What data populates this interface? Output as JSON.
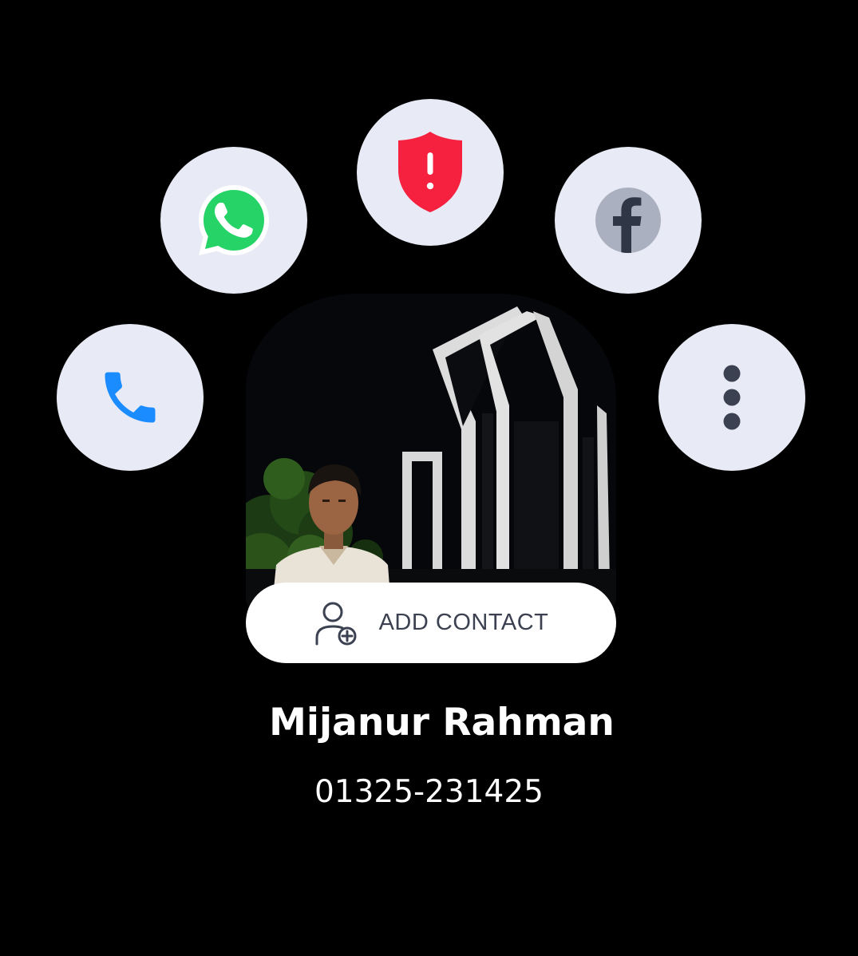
{
  "actions": {
    "call": {
      "icon": "phone-icon",
      "color": "#1a8cff"
    },
    "whatsapp": {
      "icon": "whatsapp-icon",
      "color": "#25d366"
    },
    "spam": {
      "icon": "shield-alert-icon",
      "color": "#f5213f"
    },
    "facebook": {
      "icon": "facebook-icon",
      "color": "#2f3747"
    },
    "more": {
      "icon": "more-vertical-icon",
      "color": "#3b4150"
    }
  },
  "add_contact": {
    "label": "ADD CONTACT",
    "icon": "add-person-icon"
  },
  "contact": {
    "name": "Mijanur Rahman",
    "phone": "01325-231425"
  },
  "colors": {
    "background": "#000000",
    "button_bg": "#e8ebf5",
    "text": "#ffffff"
  }
}
